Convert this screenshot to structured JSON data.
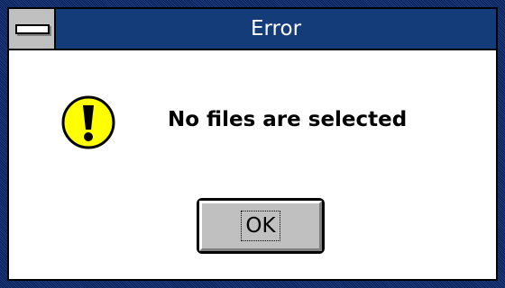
{
  "window": {
    "title": "Error",
    "system_menu_icon": "system-menu-bar"
  },
  "dialog": {
    "icon": "warning-exclamation-icon",
    "message": "No files are selected",
    "ok_label": "OK"
  },
  "colors": {
    "title_bar": "#143c78",
    "frame": "#14306e",
    "button_face": "#c0c0c0",
    "icon_fill": "#ffff00"
  }
}
